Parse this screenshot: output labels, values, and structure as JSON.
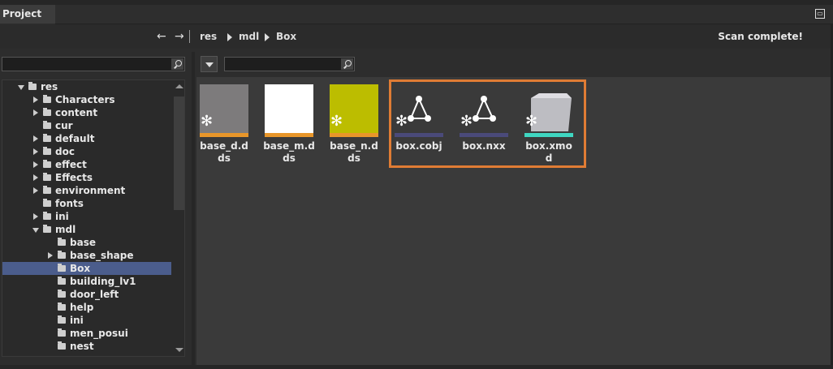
{
  "window": {
    "tab_title": "Project"
  },
  "toolbar": {
    "back_icon": "arrow-left-icon",
    "forward_icon": "arrow-right-icon",
    "breadcrumb": [
      "res",
      "mdl",
      "Box"
    ],
    "status": "Scan complete!"
  },
  "tree": {
    "items": [
      {
        "label": "res",
        "depth": 0,
        "expanded": true,
        "has_children": true,
        "selected": false
      },
      {
        "label": "Characters",
        "depth": 1,
        "expanded": false,
        "has_children": true,
        "selected": false
      },
      {
        "label": "content",
        "depth": 1,
        "expanded": false,
        "has_children": true,
        "selected": false
      },
      {
        "label": "cur",
        "depth": 1,
        "expanded": false,
        "has_children": false,
        "selected": false
      },
      {
        "label": "default",
        "depth": 1,
        "expanded": false,
        "has_children": true,
        "selected": false
      },
      {
        "label": "doc",
        "depth": 1,
        "expanded": false,
        "has_children": true,
        "selected": false
      },
      {
        "label": "effect",
        "depth": 1,
        "expanded": false,
        "has_children": true,
        "selected": false
      },
      {
        "label": "Effects",
        "depth": 1,
        "expanded": false,
        "has_children": true,
        "selected": false
      },
      {
        "label": "environment",
        "depth": 1,
        "expanded": false,
        "has_children": true,
        "selected": false
      },
      {
        "label": "fonts",
        "depth": 1,
        "expanded": false,
        "has_children": false,
        "selected": false
      },
      {
        "label": "ini",
        "depth": 1,
        "expanded": false,
        "has_children": true,
        "selected": false
      },
      {
        "label": "mdl",
        "depth": 1,
        "expanded": true,
        "has_children": true,
        "selected": false
      },
      {
        "label": "base",
        "depth": 2,
        "expanded": false,
        "has_children": false,
        "selected": false
      },
      {
        "label": "base_shape",
        "depth": 2,
        "expanded": false,
        "has_children": true,
        "selected": false
      },
      {
        "label": "Box",
        "depth": 2,
        "expanded": false,
        "has_children": false,
        "selected": true
      },
      {
        "label": "building_lv1",
        "depth": 2,
        "expanded": false,
        "has_children": false,
        "selected": false
      },
      {
        "label": "door_left",
        "depth": 2,
        "expanded": false,
        "has_children": false,
        "selected": false
      },
      {
        "label": "help",
        "depth": 2,
        "expanded": false,
        "has_children": false,
        "selected": false
      },
      {
        "label": "ini",
        "depth": 2,
        "expanded": false,
        "has_children": false,
        "selected": false
      },
      {
        "label": "men_posui",
        "depth": 2,
        "expanded": false,
        "has_children": false,
        "selected": false
      },
      {
        "label": "nest",
        "depth": 2,
        "expanded": false,
        "has_children": false,
        "selected": false
      }
    ]
  },
  "assets": [
    {
      "name": "base_d.dds",
      "name_display": "base_d.d\nds",
      "kind": "texture",
      "fill": "#7d7b7c",
      "bar_color": "#e8962a"
    },
    {
      "name": "base_m.dds",
      "name_display": "base_m.d\nds",
      "kind": "texture",
      "fill": "#ffffff",
      "bar_color": "#e8962a"
    },
    {
      "name": "base_n.dds",
      "name_display": "base_n.d\nds",
      "kind": "texture",
      "fill": "#bcbd00",
      "bar_color": "#e8962a"
    },
    {
      "name": "box.cobj",
      "name_display": "box.cobj",
      "kind": "mesh",
      "icon": "mesh-triangle-icon",
      "bar_color": "#4a4a7a"
    },
    {
      "name": "box.nxx",
      "name_display": "box.nxx",
      "kind": "mesh",
      "icon": "mesh-triangle-icon",
      "bar_color": "#4a4a7a"
    },
    {
      "name": "box.xmod",
      "name_display": "box.xmod",
      "kind": "model",
      "icon": "cube-model-icon",
      "bar_color": "#3fd6c1"
    }
  ],
  "colors": {
    "highlight": "#e07c34",
    "selection": "#4b5d8c"
  }
}
